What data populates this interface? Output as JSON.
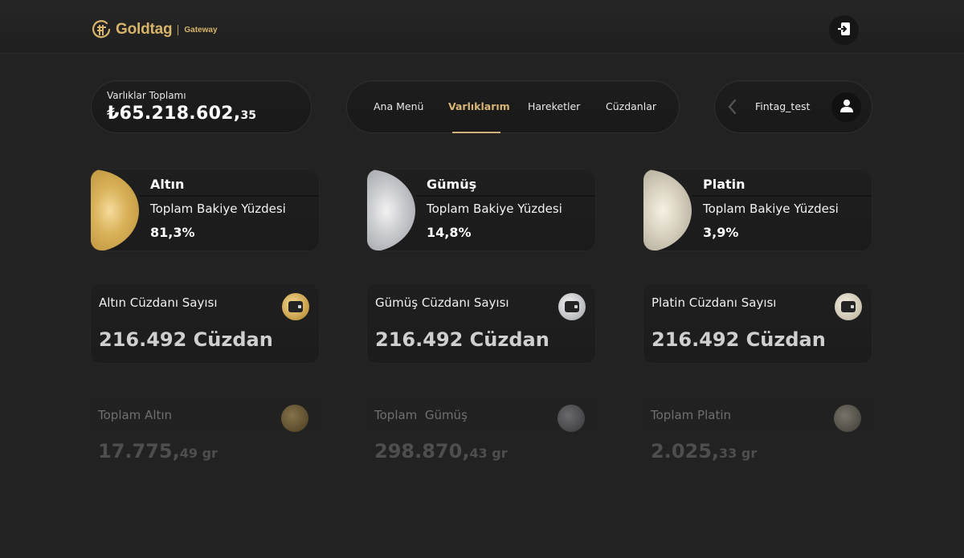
{
  "header": {
    "brand": "Goldtag",
    "brand_sub": "Gateway"
  },
  "balance": {
    "label": "Varlıklar Toplamı",
    "main": "₺65.218.602,",
    "decimal": "35"
  },
  "nav": {
    "items": [
      "Ana Menü",
      "Varlıklarım",
      "Hareketler",
      "Cüzdanlar"
    ],
    "active_index": 1
  },
  "user": {
    "name": "Fintag_test"
  },
  "metals": [
    {
      "title": "Altın",
      "subtitle": "Toplam Bakiye Yüzdesi",
      "percent": "81,3%"
    },
    {
      "title": "Gümüş",
      "subtitle": "Toplam Bakiye Yüzdesi",
      "percent": "14,8%"
    },
    {
      "title": "Platin",
      "subtitle": "Toplam Bakiye Yüzdesi",
      "percent": "3,9%"
    }
  ],
  "wallet_counts": [
    {
      "label": "Altın Cüzdanı Sayısı",
      "value": "216.492 Cüzdan"
    },
    {
      "label": "Gümüş Cüzdanı Sayısı",
      "value": "216.492 Cüzdan"
    },
    {
      "label": "Platin Cüzdanı Sayısı",
      "value": "216.492 Cüzdan"
    }
  ],
  "totals": [
    {
      "label": "Toplam Altın",
      "main": "17.775,",
      "decimal": "49",
      "unit": "gr"
    },
    {
      "label": "Toplam  Gümüş",
      "main": "298.870,",
      "decimal": "43",
      "unit": "gr"
    },
    {
      "label": "Toplam Platin",
      "main": "2.025,",
      "decimal": "33",
      "unit": "gr"
    }
  ],
  "colors": {
    "accent_gold": "#d8b677",
    "background": "#222222"
  },
  "icons": {
    "logout": "logout-icon",
    "user": "user-icon",
    "back": "chevron-left-icon",
    "wallet": "wallet-icon"
  }
}
